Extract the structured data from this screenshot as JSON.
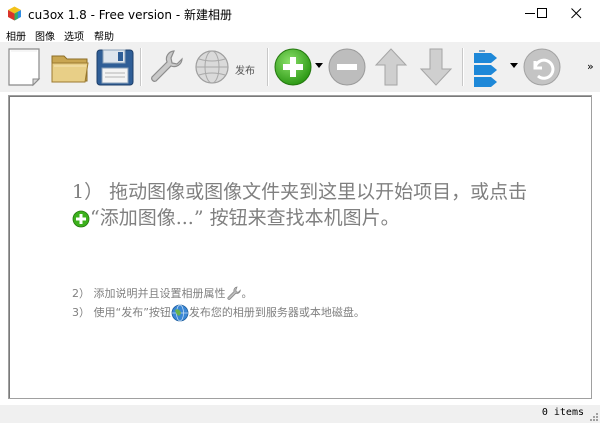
{
  "window": {
    "title": "cu3ox 1.8 - Free version - 新建相册",
    "minimize_icon": "minimize-icon",
    "maximize_icon": "maximize-icon",
    "close_icon": "close-icon"
  },
  "menu": {
    "items": [
      {
        "label": "相册"
      },
      {
        "label": "图像"
      },
      {
        "label": "选项"
      },
      {
        "label": "帮助"
      }
    ]
  },
  "toolbar": {
    "buttons": [
      {
        "name": "new-album",
        "icon": "blank-page-icon"
      },
      {
        "name": "open-album",
        "icon": "folder-icon"
      },
      {
        "name": "save-album",
        "icon": "floppy-disk-icon"
      },
      {
        "name": "album-properties",
        "icon": "wrench-icon"
      },
      {
        "name": "publish",
        "icon": "globe-icon",
        "label": "发布"
      },
      {
        "name": "add-image",
        "icon": "green-plus-icon"
      },
      {
        "name": "remove-image",
        "icon": "gray-minus-icon"
      },
      {
        "name": "move-up",
        "icon": "up-arrow-icon"
      },
      {
        "name": "move-down",
        "icon": "down-arrow-icon"
      },
      {
        "name": "sort",
        "icon": "sort-arrows-icon"
      },
      {
        "name": "undo",
        "icon": "undo-icon"
      }
    ],
    "overflow": "»"
  },
  "workspace": {
    "hint_line1_a": "1） 拖动图像或图像文件夹到这里以开始项目，或点击",
    "hint_line1_b": "“添加图像...” 按钮来查找本机图片。",
    "hint_line2_a": "2） 添加说明并且设置相册属性",
    "hint_line2_b": "。",
    "hint_line3_a": "3） 使用“发布”按钮",
    "hint_line3_b": "发布您的相册到服务器或本地磁盘。"
  },
  "status": {
    "items_count": "0 items"
  },
  "colors": {
    "toolbar_bg": "#f0f0f0",
    "hint_text": "#808080",
    "add_green": "#3cb01c"
  }
}
